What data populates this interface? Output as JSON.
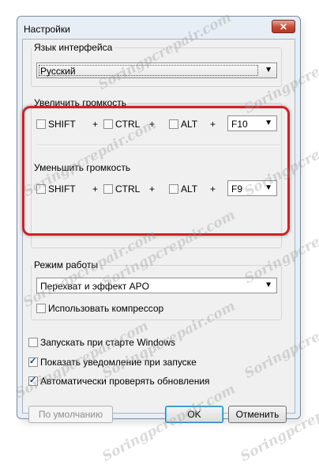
{
  "window": {
    "title": "Настройки",
    "close_symbol": "✕"
  },
  "language": {
    "label": "Язык интерфейса",
    "selected": "Русский"
  },
  "volume_up": {
    "label": "Увеличить громкость",
    "shift": {
      "label": "SHIFT",
      "checked": false
    },
    "ctrl": {
      "label": "CTRL",
      "checked": false
    },
    "alt": {
      "label": "ALT",
      "checked": false
    },
    "key": "F10",
    "plus": "+"
  },
  "volume_down": {
    "label": "Уменьшить громкость",
    "shift": {
      "label": "SHIFT",
      "checked": false
    },
    "ctrl": {
      "label": "CTRL",
      "checked": false
    },
    "alt": {
      "label": "ALT",
      "checked": false
    },
    "key": "F9",
    "plus": "+"
  },
  "mode": {
    "label": "Режим работы",
    "selected": "Перехват и эффект APO",
    "compressor": {
      "label": "Использовать компрессор",
      "checked": false
    }
  },
  "options": {
    "start_windows": {
      "label": "Запускать при старте Windows",
      "checked": false
    },
    "show_notification": {
      "label": "Показать уведомление при запуске",
      "checked": true
    },
    "auto_update": {
      "label": "Автоматически проверять обновления",
      "checked": true
    }
  },
  "buttons": {
    "default": "По умолчанию",
    "ok": "OK",
    "cancel": "Отменить"
  },
  "watermark": "Soringpcrepair.com",
  "colors": {
    "highlight": "#d41f26",
    "title_bg": "#e7eef6"
  }
}
